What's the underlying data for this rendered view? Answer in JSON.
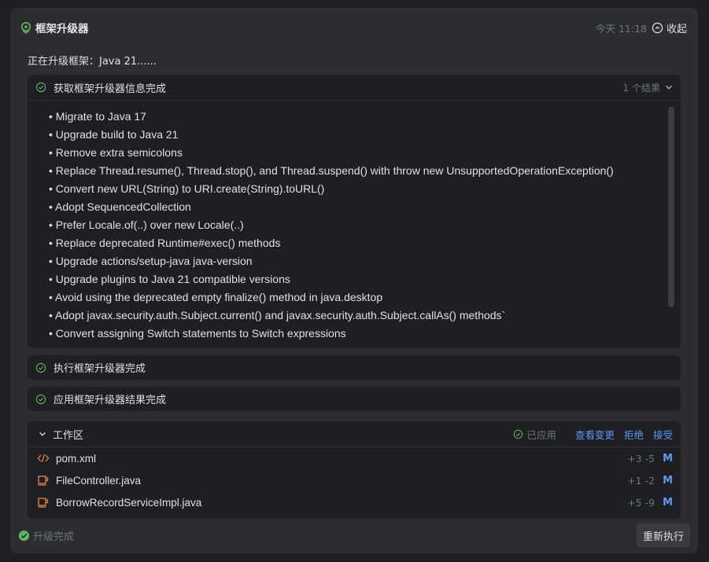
{
  "header": {
    "title": "框架升级器",
    "time": "今天 11:18",
    "collapse_label": "收起"
  },
  "status_line": "正在升级框架：Java 21......",
  "fetch_section": {
    "label": "获取框架升级器信息完成",
    "result_count": "1 个结果",
    "items": [
      "Migrate to Java 17",
      "Upgrade build to Java 21",
      "Remove extra semicolons",
      "Replace Thread.resume(), Thread.stop(), and Thread.suspend() with throw new UnsupportedOperationException()",
      "Convert new URL(String) to URI.create(String).toURL()",
      "Adopt SequencedCollection",
      "Prefer Locale.of(..) over new Locale(..)",
      "Replace deprecated Runtime#exec() methods",
      "Upgrade actions/setup-java java-version",
      "Upgrade plugins to Java 21 compatible versions",
      "Avoid using the deprecated empty finalize() method in java.desktop",
      "Adopt javax.security.auth.Subject.current() and javax.security.auth.Subject.callAs() methods`",
      "Convert assigning Switch statements to Switch expressions"
    ]
  },
  "execute_section": {
    "label": "执行框架升级器完成"
  },
  "apply_section": {
    "label": "应用框架升级器结果完成"
  },
  "workspace": {
    "label": "工作区",
    "applied_label": "已应用",
    "view_changes": "查看变更",
    "reject": "拒绝",
    "accept": "接受",
    "files": [
      {
        "name": "pom.xml",
        "icon": "code-icon",
        "diff": "+3 -5",
        "status": "M"
      },
      {
        "name": "FileController.java",
        "icon": "java-file-icon",
        "diff": "+1 -2",
        "status": "M"
      },
      {
        "name": "BorrowRecordServiceImpl.java",
        "icon": "java-file-icon",
        "diff": "+5 -9",
        "status": "M"
      }
    ]
  },
  "footer": {
    "done_label": "升级完成",
    "rerun_label": "重新执行"
  },
  "colors": {
    "background": "#1e1f22",
    "card": "#2b2d30",
    "accent_link": "#5e96f6",
    "success": "#5fb85f",
    "file_icon": "#e8854a"
  }
}
